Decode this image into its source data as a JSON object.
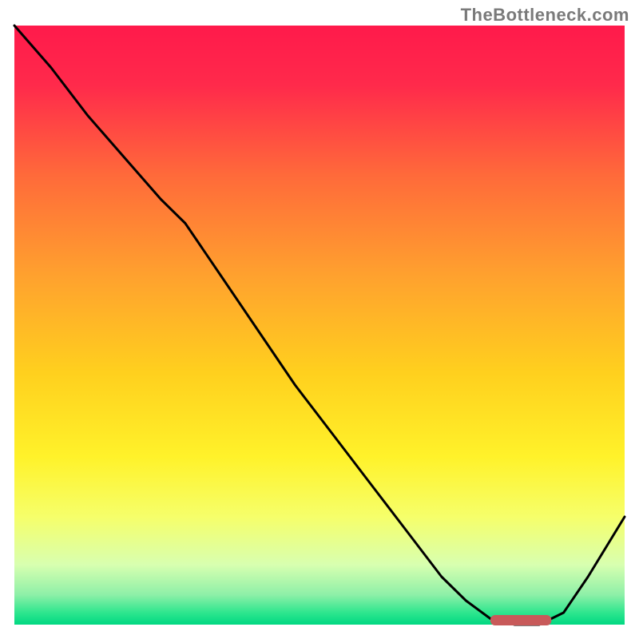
{
  "watermark": "TheBottleneck.com",
  "chart_data": {
    "type": "line",
    "title": "",
    "xlabel": "",
    "ylabel": "",
    "xlim": [
      0,
      100
    ],
    "ylim": [
      0,
      100
    ],
    "grid": false,
    "legend": false,
    "background_gradient_stops": [
      {
        "offset": 0.0,
        "color": "#ff1a4b"
      },
      {
        "offset": 0.1,
        "color": "#ff2a4b"
      },
      {
        "offset": 0.25,
        "color": "#ff6a3a"
      },
      {
        "offset": 0.42,
        "color": "#ffa22e"
      },
      {
        "offset": 0.58,
        "color": "#ffd01e"
      },
      {
        "offset": 0.72,
        "color": "#fff22a"
      },
      {
        "offset": 0.82,
        "color": "#f6ff6a"
      },
      {
        "offset": 0.9,
        "color": "#d8ffb0"
      },
      {
        "offset": 0.95,
        "color": "#8ef0a8"
      },
      {
        "offset": 0.98,
        "color": "#2ee68e"
      },
      {
        "offset": 1.0,
        "color": "#00d882"
      }
    ],
    "series": [
      {
        "name": "bottleneck-curve",
        "color": "#000000",
        "width": 3,
        "x": [
          0,
          6,
          12,
          18,
          24,
          28,
          34,
          40,
          46,
          52,
          58,
          64,
          70,
          74,
          78,
          82,
          86,
          90,
          94,
          100
        ],
        "y": [
          100,
          93,
          85,
          78,
          71,
          67,
          58,
          49,
          40,
          32,
          24,
          16,
          8,
          4,
          1,
          0,
          0,
          2,
          8,
          18
        ]
      }
    ],
    "annotations": [
      {
        "name": "optimal-range-marker",
        "shape": "rounded-rect",
        "x0": 78,
        "x1": 88,
        "y": 0.8,
        "color": "#c85a5a"
      }
    ]
  }
}
